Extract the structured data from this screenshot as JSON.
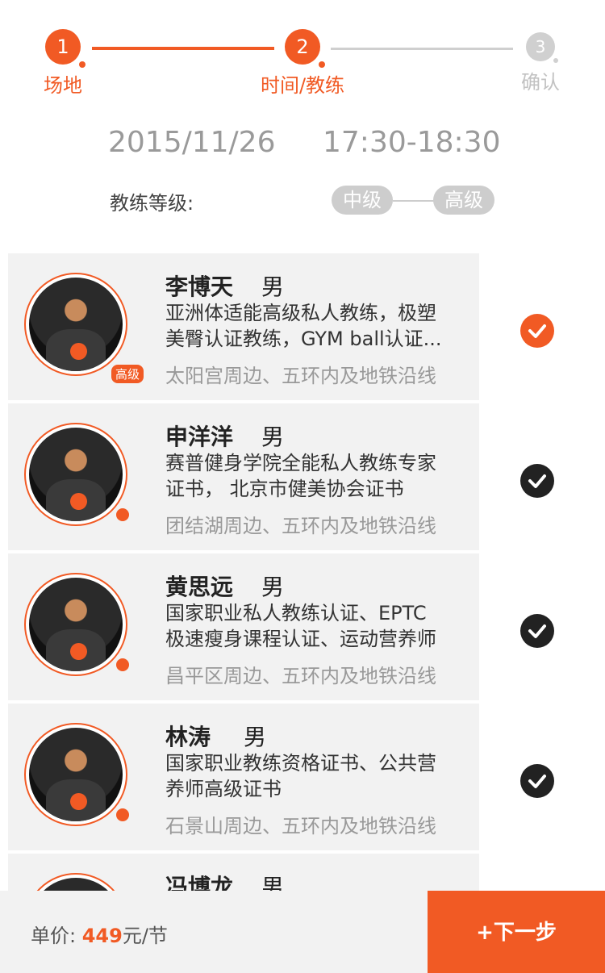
{
  "stepper": {
    "steps": [
      {
        "num": "1",
        "label": "场地"
      },
      {
        "num": "2",
        "label": "时间/教练"
      },
      {
        "num": "3",
        "label": "确认"
      }
    ]
  },
  "schedule": {
    "date": "2015/11/26",
    "time": "17:30-18:30"
  },
  "level": {
    "label": "教练等级:",
    "min": "中级",
    "max": "高级"
  },
  "coaches": [
    {
      "name": "李博天",
      "gender": "男",
      "desc_line1": "亚洲体适能高级私人教练，极塑",
      "desc_line2": "美臀认证教练，GYM ball认证...",
      "area": "太阳宫周边、五环内及地铁沿线",
      "level_badge": "高级",
      "selected": true
    },
    {
      "name": "申洋洋",
      "gender": "男",
      "desc_line1": "赛普健身学院全能私人教练专家",
      "desc_line2": "证书， 北京市健美协会证书",
      "area": "团结湖周边、五环内及地铁沿线",
      "selected": false
    },
    {
      "name": "黄思远",
      "gender": "男",
      "desc_line1": "国家职业私人教练认证、EPTC",
      "desc_line2": "极速瘦身课程认证、运动营养师",
      "area": "昌平区周边、五环内及地铁沿线",
      "selected": false
    },
    {
      "name": "林涛",
      "gender": "男",
      "desc_line1": "国家职业教练资格证书、公共营",
      "desc_line2": "养师高级证书",
      "area": "石景山周边、五环内及地铁沿线",
      "selected": false
    },
    {
      "name": "冯博龙",
      "gender": "男",
      "desc_line1": "",
      "desc_line2": "",
      "area": "",
      "selected": false
    }
  ],
  "bottom": {
    "price_label": "单价:",
    "price_value": "449",
    "price_unit": "元/节",
    "next_label": "+下一步"
  },
  "colors": {
    "accent": "#f15a24",
    "inactive": "#cdcdcd"
  },
  "icons": {
    "check": "check-icon"
  }
}
